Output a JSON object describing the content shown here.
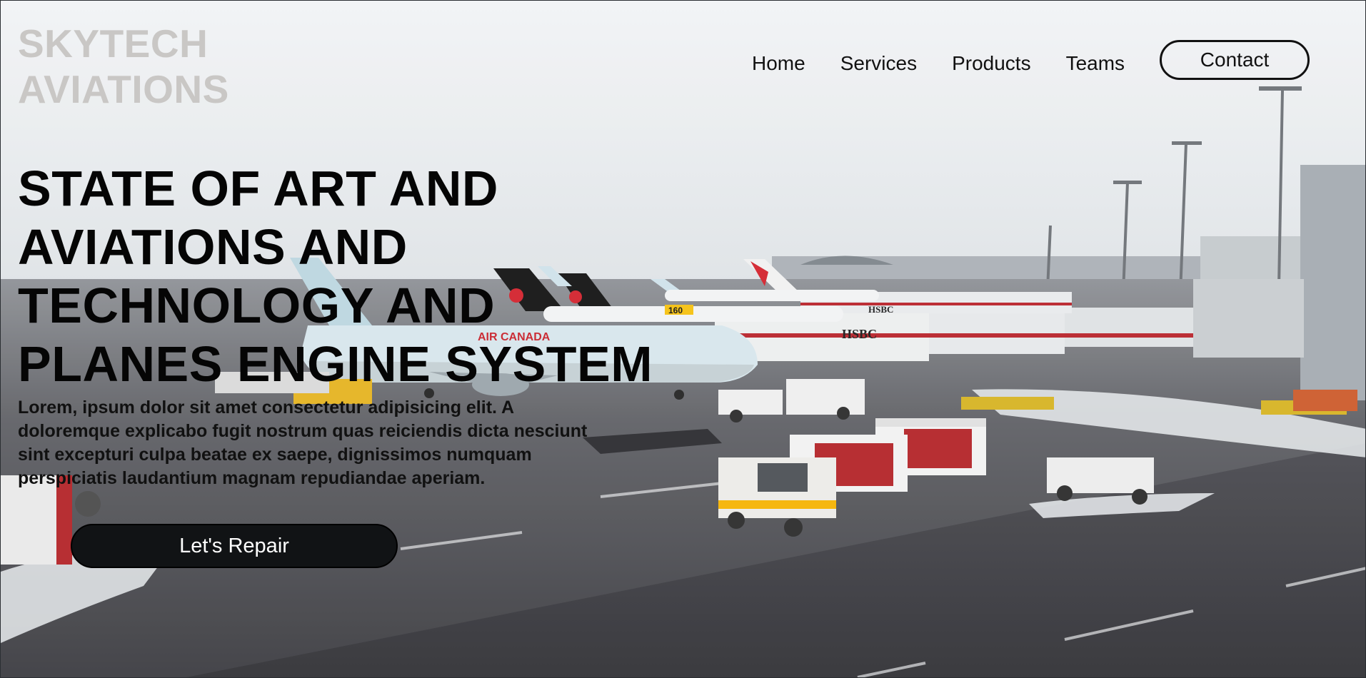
{
  "brand": {
    "line1": "SKYTECH",
    "line2": "AVIATIONS"
  },
  "nav": {
    "items": [
      {
        "label": "Home"
      },
      {
        "label": "Services"
      },
      {
        "label": "Products"
      },
      {
        "label": "Teams"
      }
    ],
    "contact_label": "Contact"
  },
  "hero": {
    "headline_lines": [
      "STATE OF ART AND",
      "AVIATIONS AND",
      "TECHNOLOGY AND",
      "PLANES ENGINE SYSTEM"
    ],
    "lead_lines": [
      "Lorem, ipsum dolor sit amet consectetur adipisicing elit. A",
      "doloremque explicabo fugit nostrum quas reiciendis dicta nesciunt",
      "sint excepturi culpa beatae ex saepe, dignissimos numquam",
      "perspiciatis laudantium magnam repudiandae aperiam."
    ],
    "cta_label": "Let's Repair",
    "background_image": {
      "bridge_sign_1": "HSBC",
      "bridge_sign_2": "HSBC",
      "aircraft_livery": "AIR CANADA",
      "gate_number": "160"
    }
  },
  "colors": {
    "brand_text": "#c9c7c5",
    "headline": "#050505",
    "cta_bg": "#111315",
    "cta_text": "#ffffff"
  }
}
